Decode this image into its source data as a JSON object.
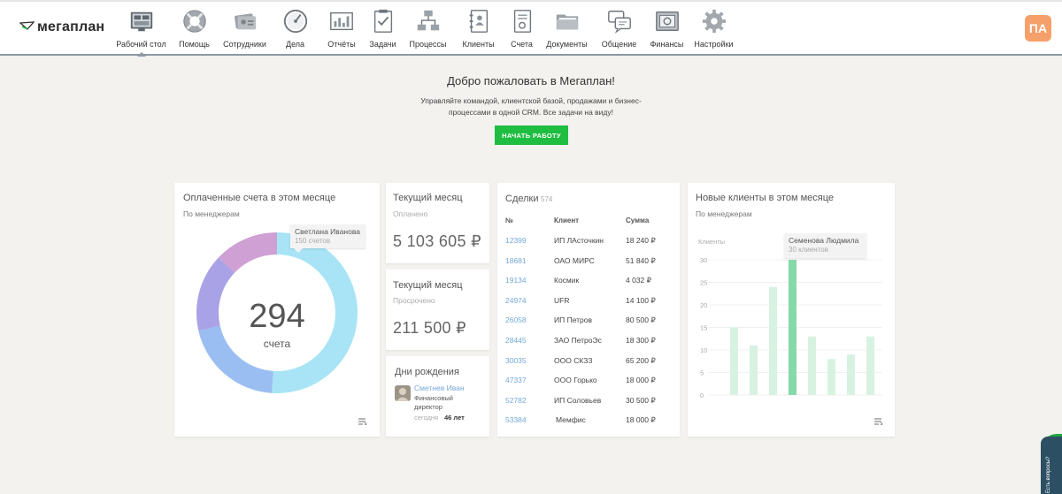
{
  "app": {
    "logo_text": "мегаплан",
    "avatar": "ПА"
  },
  "nav": [
    {
      "label": "Рабочий стол",
      "icon": "desktop-icon",
      "active": true
    },
    {
      "label": "Помощь",
      "icon": "lifebuoy-icon"
    },
    {
      "label": "Сотрудники",
      "icon": "employees-icon"
    },
    {
      "label": "Дела",
      "icon": "compass-icon"
    },
    {
      "label": "Отчёты",
      "icon": "report-chart-icon"
    },
    {
      "label": "Задачи",
      "icon": "clipboard-check-icon"
    },
    {
      "label": "Процессы",
      "icon": "flowchart-icon"
    },
    {
      "label": "Клиенты",
      "icon": "address-book-icon"
    },
    {
      "label": "Счета",
      "icon": "invoice-icon"
    },
    {
      "label": "Документы",
      "icon": "folder-icon"
    },
    {
      "label": "Общение",
      "icon": "chat-icon"
    },
    {
      "label": "Финансы",
      "icon": "safe-icon"
    },
    {
      "label": "Настройки",
      "icon": "gear-icon"
    }
  ],
  "welcome": {
    "title": "Добро пожаловать в Мегаплан!",
    "text": "Управляйте командой, клиентской базой, продажами и бизнес-процессами в одной CRM. Все задачи на виду!",
    "button": "НАЧАТЬ РАБОТУ"
  },
  "invoices_card": {
    "title": "Оплаченные счета в этом месяце",
    "subtitle": "По менеджерам",
    "center_value": "294",
    "center_label": "счета",
    "tooltip_name": "Светлана Иванова",
    "tooltip_value": "150 счетов"
  },
  "paid_card": {
    "title": "Текущий месяц",
    "label": "Оплачено",
    "value": "5 103 605 ₽"
  },
  "overdue_card": {
    "title": "Текущий месяц",
    "label": "Просрочено",
    "value": "211 500 ₽"
  },
  "birthday_card": {
    "title": "Дни рождения",
    "name": "Сметнев Иван",
    "position_line1": "Финансовый",
    "position_line2": "директор",
    "today": "сегодня",
    "age": "46 лет"
  },
  "deals_card": {
    "title": "Сделки",
    "count": "574",
    "headers": {
      "num": "№",
      "client": "Клиент",
      "sum": "Сумма"
    },
    "rows": [
      {
        "id": "12399",
        "client": "ИП ЛАсточкин",
        "sum": "18 240 ₽"
      },
      {
        "id": "18681",
        "client": "ОАО МИРС",
        "sum": "51 840 ₽"
      },
      {
        "id": "19134",
        "client": "Космик",
        "sum": "4 032 ₽"
      },
      {
        "id": "24974",
        "client": "UFR",
        "sum": "14 100 ₽"
      },
      {
        "id": "26058",
        "client": "ИП Петров",
        "sum": "80 500 ₽"
      },
      {
        "id": "28445",
        "client": "ЗАО ПетроЭс",
        "sum": "18 300 ₽"
      },
      {
        "id": "30035",
        "client": "ООО СКЗЗ",
        "sum": "65 200 ₽"
      },
      {
        "id": "47337",
        "client": "ООО Горько",
        "sum": "18 000 ₽"
      },
      {
        "id": "52782",
        "client": "ИП Соловьев",
        "sum": "30 500 ₽"
      },
      {
        "id": "53384",
        "client": "Мемфис",
        "sum": "18 000 ₽"
      }
    ]
  },
  "clients_card": {
    "title": "Новые клиенты в этом месяце",
    "subtitle": "По менеджерам",
    "tooltip_name": "Семенова Людмила",
    "tooltip_value": "30 клиентов"
  },
  "help_tab": {
    "text": "Есть вопросы?"
  },
  "colors": {
    "accent_green": "#1fbd41",
    "link_blue": "#74a8d6",
    "donut_light_blue": "#a8e4f6",
    "donut_blue": "#9bbef2",
    "donut_purple": "#aaa2e6",
    "donut_pink": "#cfa0d3",
    "bar_light": "#d8f2e2",
    "bar_active": "#86d9a9"
  },
  "chart_data": [
    {
      "type": "pie",
      "title": "Оплаченные счета в этом месяце",
      "subtitle": "По менеджерам",
      "total": 294,
      "total_label": "счета",
      "slices": [
        {
          "name": "Светлана Иванова",
          "value": 150,
          "color": "#a8e4f6"
        },
        {
          "value": 60,
          "color": "#9bbef2"
        },
        {
          "value": 46,
          "color": "#aaa2e6"
        },
        {
          "value": 38,
          "color": "#cfa0d3"
        }
      ]
    },
    {
      "type": "bar",
      "title": "Новые клиенты в этом месяце",
      "subtitle": "По менеджерам",
      "ylabel": "Клиенты",
      "ylim": [
        0,
        30
      ],
      "yticks": [
        0,
        5,
        10,
        15,
        20,
        25,
        30
      ],
      "values": [
        15,
        11,
        24,
        30,
        13,
        8,
        9,
        13
      ],
      "highlight_index": 3,
      "highlight_name": "Семенова Людмила",
      "highlight_label": "30 клиентов",
      "grid": true
    }
  ]
}
